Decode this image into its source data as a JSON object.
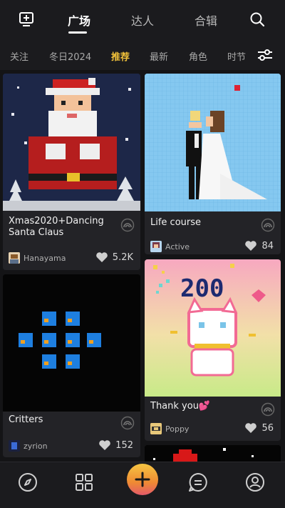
{
  "top_tabs": [
    {
      "label": "广场",
      "active": true
    },
    {
      "label": "达人",
      "active": false
    },
    {
      "label": "合辑",
      "active": false
    }
  ],
  "categories": [
    {
      "label": "关注",
      "active": false
    },
    {
      "label": "冬日2024",
      "active": false
    },
    {
      "label": "推荐",
      "active": true
    },
    {
      "label": "最新",
      "active": false
    },
    {
      "label": "角色",
      "active": false
    },
    {
      "label": "时节",
      "active": false
    }
  ],
  "icons": {
    "top_left": "tv-plus-icon",
    "search": "search-icon",
    "filter": "sliders-icon",
    "badge": "rainbow-badge-icon",
    "like": "heart-icon"
  },
  "posts": [
    {
      "title": "Xmas2020+Dancing Santa Claus",
      "author": "Hanayama",
      "likes": "5.2K"
    },
    {
      "title": "Life course",
      "author": "Active",
      "likes": "84"
    },
    {
      "title": "Critters",
      "author": "zyrion",
      "likes": "152"
    },
    {
      "title": "Thank you💕",
      "author": "Poppy",
      "likes": "56"
    }
  ],
  "bottom_nav": [
    {
      "name": "discover"
    },
    {
      "name": "grid"
    },
    {
      "name": "create"
    },
    {
      "name": "messages"
    },
    {
      "name": "profile"
    }
  ],
  "colors": {
    "accent": "#f2c23a",
    "background": "#141416",
    "card": "#232327"
  }
}
